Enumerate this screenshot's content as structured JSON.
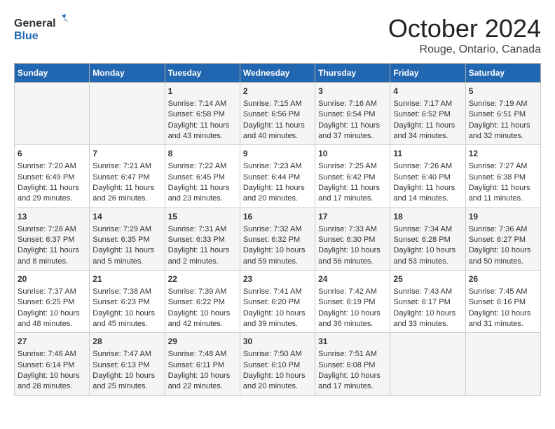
{
  "header": {
    "logo_line1": "General",
    "logo_line2": "Blue",
    "month": "October 2024",
    "location": "Rouge, Ontario, Canada"
  },
  "weekdays": [
    "Sunday",
    "Monday",
    "Tuesday",
    "Wednesday",
    "Thursday",
    "Friday",
    "Saturday"
  ],
  "weeks": [
    [
      {
        "day": "",
        "content": ""
      },
      {
        "day": "",
        "content": ""
      },
      {
        "day": "1",
        "content": "Sunrise: 7:14 AM\nSunset: 6:58 PM\nDaylight: 11 hours and 43 minutes."
      },
      {
        "day": "2",
        "content": "Sunrise: 7:15 AM\nSunset: 6:56 PM\nDaylight: 11 hours and 40 minutes."
      },
      {
        "day": "3",
        "content": "Sunrise: 7:16 AM\nSunset: 6:54 PM\nDaylight: 11 hours and 37 minutes."
      },
      {
        "day": "4",
        "content": "Sunrise: 7:17 AM\nSunset: 6:52 PM\nDaylight: 11 hours and 34 minutes."
      },
      {
        "day": "5",
        "content": "Sunrise: 7:19 AM\nSunset: 6:51 PM\nDaylight: 11 hours and 32 minutes."
      }
    ],
    [
      {
        "day": "6",
        "content": "Sunrise: 7:20 AM\nSunset: 6:49 PM\nDaylight: 11 hours and 29 minutes."
      },
      {
        "day": "7",
        "content": "Sunrise: 7:21 AM\nSunset: 6:47 PM\nDaylight: 11 hours and 26 minutes."
      },
      {
        "day": "8",
        "content": "Sunrise: 7:22 AM\nSunset: 6:45 PM\nDaylight: 11 hours and 23 minutes."
      },
      {
        "day": "9",
        "content": "Sunrise: 7:23 AM\nSunset: 6:44 PM\nDaylight: 11 hours and 20 minutes."
      },
      {
        "day": "10",
        "content": "Sunrise: 7:25 AM\nSunset: 6:42 PM\nDaylight: 11 hours and 17 minutes."
      },
      {
        "day": "11",
        "content": "Sunrise: 7:26 AM\nSunset: 6:40 PM\nDaylight: 11 hours and 14 minutes."
      },
      {
        "day": "12",
        "content": "Sunrise: 7:27 AM\nSunset: 6:38 PM\nDaylight: 11 hours and 11 minutes."
      }
    ],
    [
      {
        "day": "13",
        "content": "Sunrise: 7:28 AM\nSunset: 6:37 PM\nDaylight: 11 hours and 8 minutes."
      },
      {
        "day": "14",
        "content": "Sunrise: 7:29 AM\nSunset: 6:35 PM\nDaylight: 11 hours and 5 minutes."
      },
      {
        "day": "15",
        "content": "Sunrise: 7:31 AM\nSunset: 6:33 PM\nDaylight: 11 hours and 2 minutes."
      },
      {
        "day": "16",
        "content": "Sunrise: 7:32 AM\nSunset: 6:32 PM\nDaylight: 10 hours and 59 minutes."
      },
      {
        "day": "17",
        "content": "Sunrise: 7:33 AM\nSunset: 6:30 PM\nDaylight: 10 hours and 56 minutes."
      },
      {
        "day": "18",
        "content": "Sunrise: 7:34 AM\nSunset: 6:28 PM\nDaylight: 10 hours and 53 minutes."
      },
      {
        "day": "19",
        "content": "Sunrise: 7:36 AM\nSunset: 6:27 PM\nDaylight: 10 hours and 50 minutes."
      }
    ],
    [
      {
        "day": "20",
        "content": "Sunrise: 7:37 AM\nSunset: 6:25 PM\nDaylight: 10 hours and 48 minutes."
      },
      {
        "day": "21",
        "content": "Sunrise: 7:38 AM\nSunset: 6:23 PM\nDaylight: 10 hours and 45 minutes."
      },
      {
        "day": "22",
        "content": "Sunrise: 7:39 AM\nSunset: 6:22 PM\nDaylight: 10 hours and 42 minutes."
      },
      {
        "day": "23",
        "content": "Sunrise: 7:41 AM\nSunset: 6:20 PM\nDaylight: 10 hours and 39 minutes."
      },
      {
        "day": "24",
        "content": "Sunrise: 7:42 AM\nSunset: 6:19 PM\nDaylight: 10 hours and 36 minutes."
      },
      {
        "day": "25",
        "content": "Sunrise: 7:43 AM\nSunset: 6:17 PM\nDaylight: 10 hours and 33 minutes."
      },
      {
        "day": "26",
        "content": "Sunrise: 7:45 AM\nSunset: 6:16 PM\nDaylight: 10 hours and 31 minutes."
      }
    ],
    [
      {
        "day": "27",
        "content": "Sunrise: 7:46 AM\nSunset: 6:14 PM\nDaylight: 10 hours and 28 minutes."
      },
      {
        "day": "28",
        "content": "Sunrise: 7:47 AM\nSunset: 6:13 PM\nDaylight: 10 hours and 25 minutes."
      },
      {
        "day": "29",
        "content": "Sunrise: 7:48 AM\nSunset: 6:11 PM\nDaylight: 10 hours and 22 minutes."
      },
      {
        "day": "30",
        "content": "Sunrise: 7:50 AM\nSunset: 6:10 PM\nDaylight: 10 hours and 20 minutes."
      },
      {
        "day": "31",
        "content": "Sunrise: 7:51 AM\nSunset: 6:08 PM\nDaylight: 10 hours and 17 minutes."
      },
      {
        "day": "",
        "content": ""
      },
      {
        "day": "",
        "content": ""
      }
    ]
  ]
}
